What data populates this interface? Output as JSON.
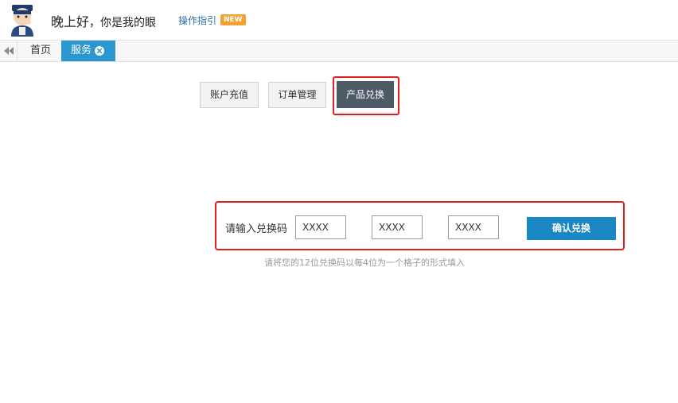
{
  "header": {
    "greeting_main": "晚上好",
    "greeting_sub": "，你是我的眼",
    "guide_link": "操作指引",
    "new_badge": "NEW"
  },
  "tabs": {
    "home_label": "首页",
    "service_label": "服务"
  },
  "nav_buttons": {
    "recharge": "账户充值",
    "orders": "订单管理",
    "redeem": "产品兑换"
  },
  "redeem_form": {
    "label": "请输入兑换码",
    "input_placeholder": "XXXX",
    "confirm_button": "确认兑换",
    "hint": "请将您的12位兑换码以每4位为一个格子的形式填入"
  },
  "colors": {
    "accent_blue": "#1a86c4",
    "tab_active": "#2b97cf",
    "highlight_red": "#e02020",
    "active_button": "#4e5a66",
    "new_badge": "#f5a032"
  }
}
